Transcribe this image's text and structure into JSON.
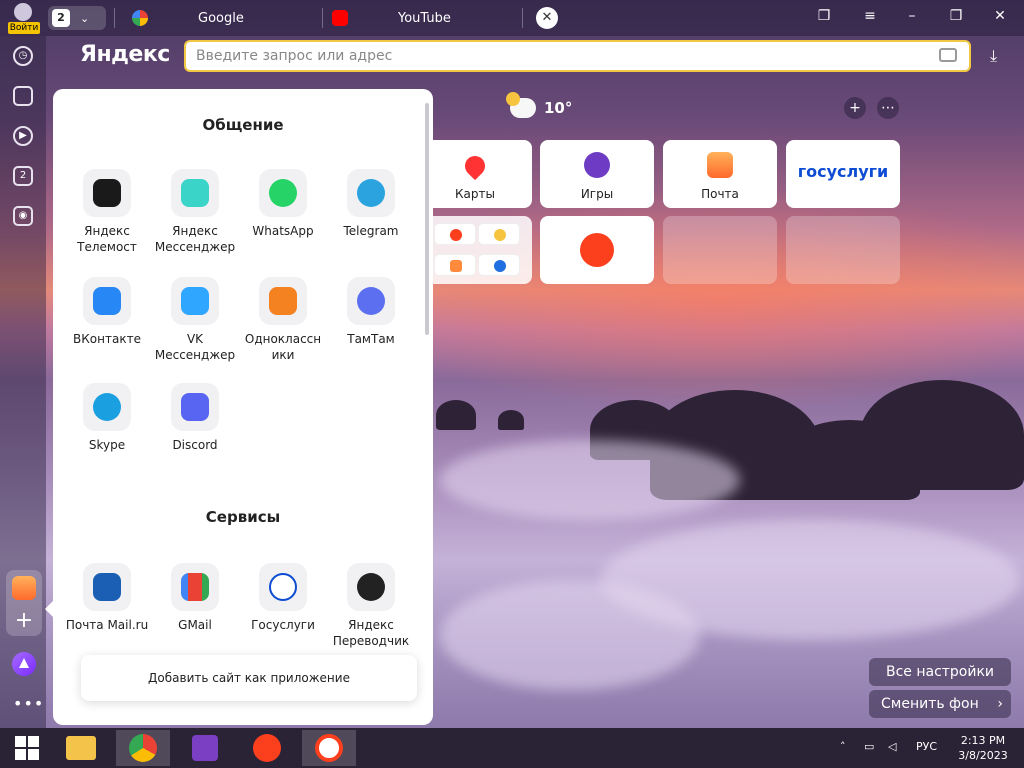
{
  "tabbar": {
    "login_label": "Войти",
    "tab_count": "2",
    "tabs": [
      {
        "title": "Google"
      },
      {
        "title": "YouTube"
      }
    ]
  },
  "address": {
    "brand": "Яндекс",
    "placeholder": "Введите запрос или адрес"
  },
  "popup": {
    "section_communication": "Общение",
    "apps_communication": [
      {
        "label": "Яндекс Телемост"
      },
      {
        "label": "Яндекс Мессенджер"
      },
      {
        "label": "WhatsApp"
      },
      {
        "label": "Telegram"
      },
      {
        "label": "ВКонтакте"
      },
      {
        "label": "VK Мессенджер"
      },
      {
        "label": "Одноклассники"
      },
      {
        "label": "ТамТам"
      },
      {
        "label": "Skype"
      },
      {
        "label": "Discord"
      }
    ],
    "section_services": "Сервисы",
    "apps_services": [
      {
        "label": "Почта Mail.ru"
      },
      {
        "label": "GMail"
      },
      {
        "label": "Госуслуги"
      },
      {
        "label": "Яндекс Переводчик"
      }
    ],
    "add_site_label": "Добавить сайт как приложение"
  },
  "dashboard": {
    "weather_temp": "10°",
    "cards": [
      {
        "label": "Карты"
      },
      {
        "label": "Игры"
      },
      {
        "label": "Почта"
      },
      {
        "label": "госуслуги"
      }
    ]
  },
  "bottom": {
    "all_settings": "Все настройки",
    "change_bg": "Сменить фон"
  },
  "taskbar": {
    "lang": "РУС",
    "time": "2:13 PM",
    "date": "3/8/2023"
  },
  "colors": {
    "accent_yellow": "#f2c744",
    "yandex_red": "#fc3f1d"
  }
}
